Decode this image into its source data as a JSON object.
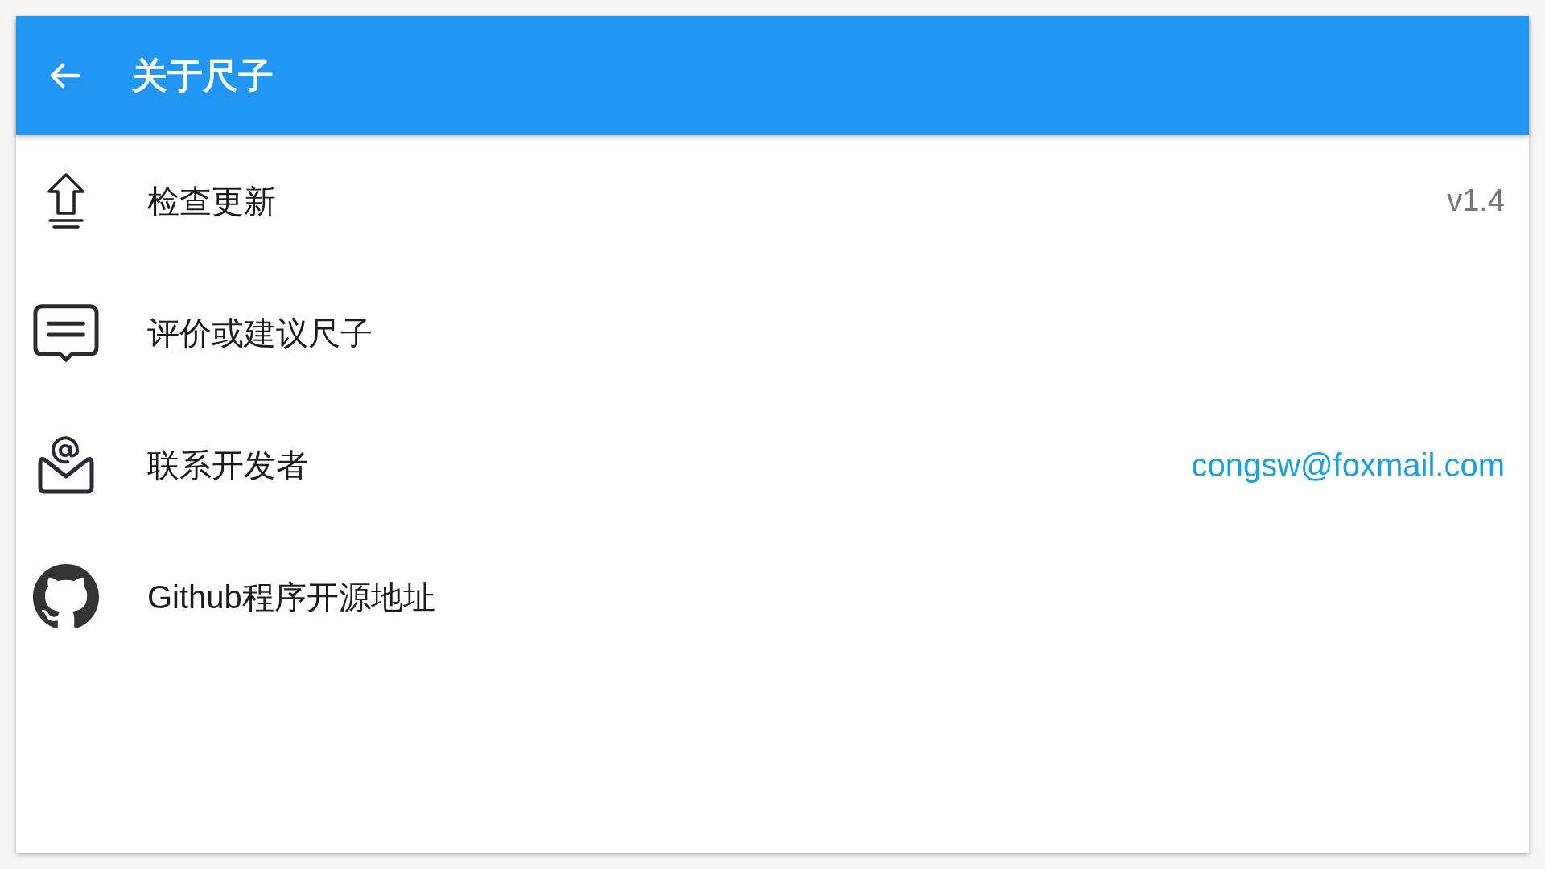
{
  "app_bar": {
    "title": "关于尺子"
  },
  "items": [
    {
      "label": "检查更新",
      "value": {
        "kind": "text",
        "text": "v1.4"
      }
    },
    {
      "label": "评价或建议尺子"
    },
    {
      "label": "联系开发者",
      "value": {
        "kind": "link",
        "text": "congsw@foxmail.com"
      }
    },
    {
      "label": "Github程序开源地址"
    }
  ]
}
